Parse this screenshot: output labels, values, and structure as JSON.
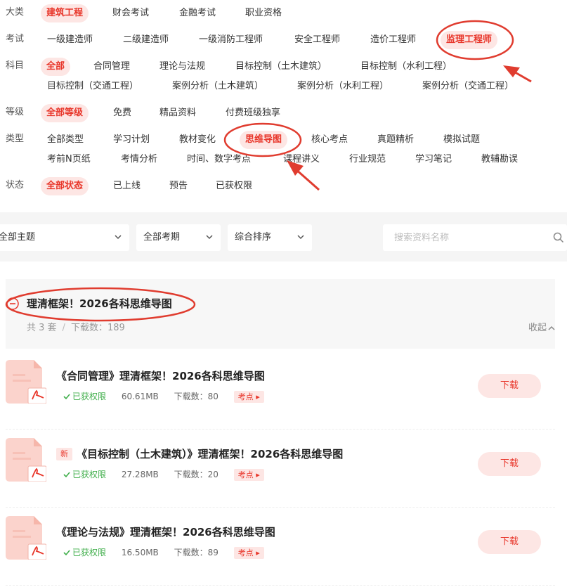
{
  "filters": {
    "category": {
      "label": "大类",
      "options": [
        "建筑工程",
        "财会考试",
        "金融考试",
        "职业资格"
      ],
      "active": 0
    },
    "exam": {
      "label": "考试",
      "options": [
        "一级建造师",
        "二级建造师",
        "一级消防工程师",
        "安全工程师",
        "造价工程师",
        "监理工程师"
      ],
      "active": 5
    },
    "subject": {
      "label": "科目",
      "options": [
        "全部",
        "合同管理",
        "理论与法规",
        "目标控制（土木建筑）",
        "目标控制（水利工程）",
        "目标控制（交通工程）",
        "案例分析（土木建筑）",
        "案例分析（水利工程）",
        "案例分析（交通工程）"
      ],
      "active": 0
    },
    "level": {
      "label": "等级",
      "options": [
        "全部等级",
        "免费",
        "精品资料",
        "付费班级独享"
      ],
      "active": 0
    },
    "type": {
      "label": "类型",
      "options": [
        "全部类型",
        "学习计划",
        "教材变化",
        "思维导图",
        "核心考点",
        "真题精析",
        "模拟试题",
        "考前N页纸",
        "考情分析",
        "时间、数字考点",
        "课程讲义",
        "行业规范",
        "学习笔记",
        "教辅勘误"
      ],
      "active": 3
    },
    "status": {
      "label": "状态",
      "options": [
        "全部状态",
        "已上线",
        "预告",
        "已获权限"
      ],
      "active": 0
    }
  },
  "toolbar": {
    "theme": "全部主题",
    "period": "全部考期",
    "sort": "综合排序",
    "search_placeholder": "搜索资料名称"
  },
  "group": {
    "title": "理清框架！2026各科思维导图",
    "count": "共 3 套",
    "sep": "/",
    "downloads": "下载数：189",
    "collapse": "收起"
  },
  "items": [
    {
      "title": "《合同管理》理清框架！2026各科思维导图",
      "is_new": false,
      "permission": "已获权限",
      "size": "60.61MB",
      "downloads": "下载数：80",
      "tag": "考点",
      "button": "下载"
    },
    {
      "title": "《目标控制（土木建筑）》理清框架！2026各科思维导图",
      "is_new": true,
      "new_label": "新",
      "permission": "已获权限",
      "size": "27.28MB",
      "downloads": "下载数：20",
      "tag": "考点",
      "button": "下载"
    },
    {
      "title": "《理论与法规》理清框架！2026各科思维导图",
      "is_new": false,
      "permission": "已获权限",
      "size": "16.50MB",
      "downloads": "下载数：89",
      "tag": "考点",
      "button": "下载"
    }
  ],
  "colors": {
    "accent": "#e8362a",
    "accent_bg": "#fde6e4",
    "success": "#3fae4a",
    "annotation": "#e03c2f"
  }
}
